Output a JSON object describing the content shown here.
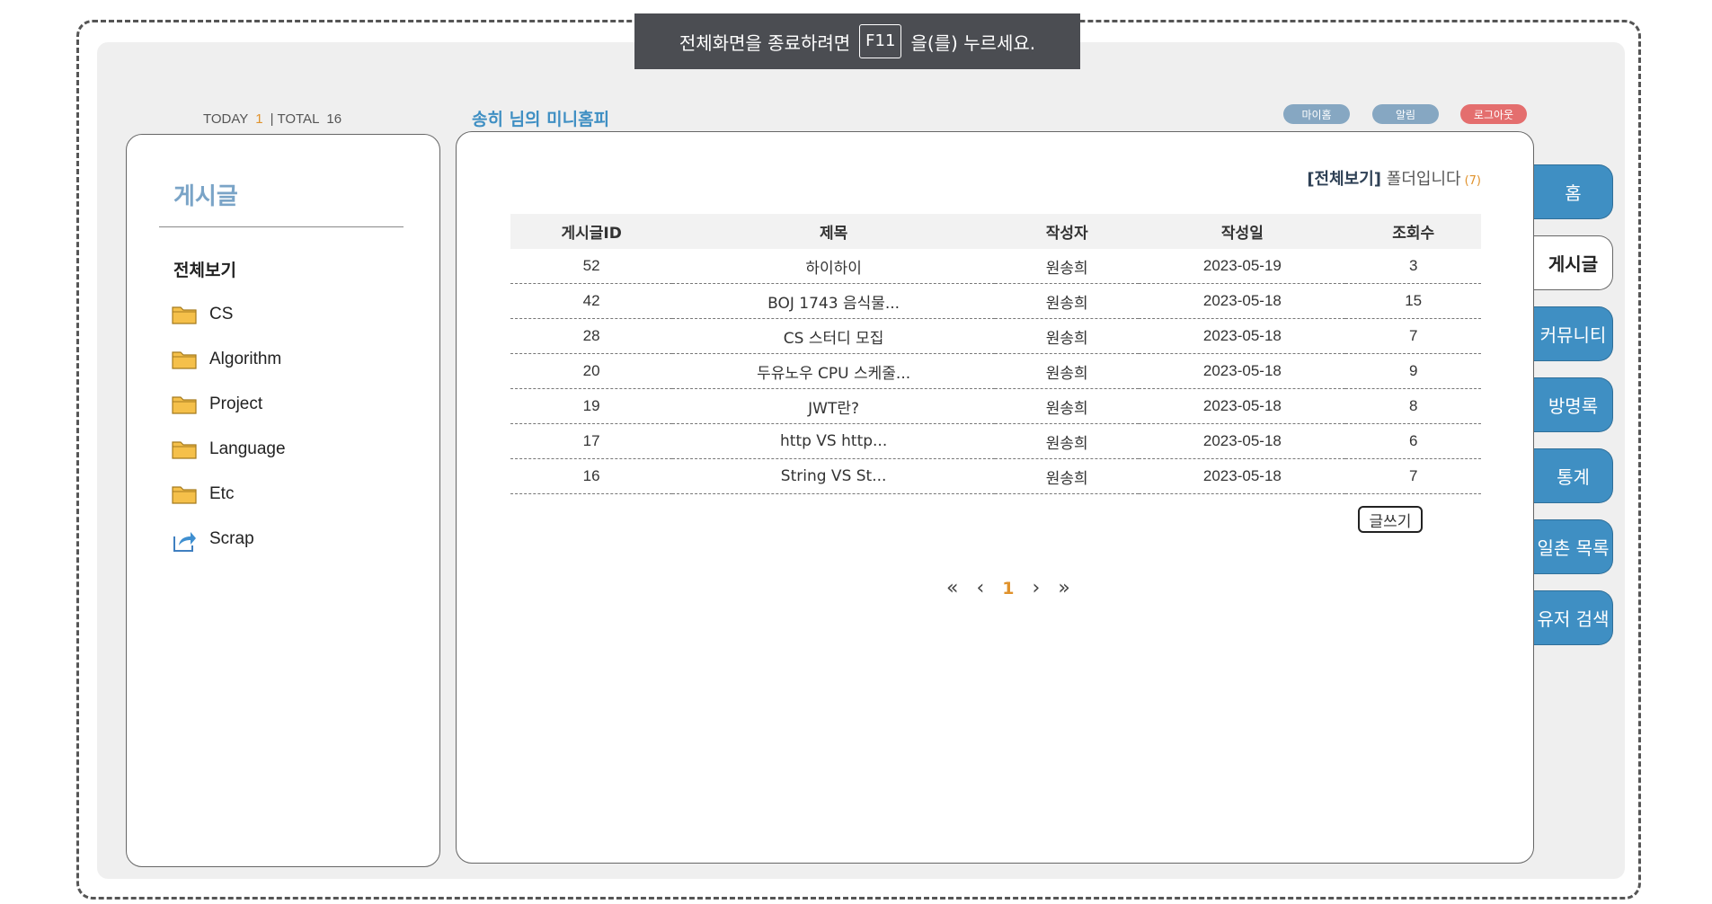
{
  "fullscreen_notice": {
    "before": "전체화면을 종료하려면",
    "key": "F11",
    "after": "을(를) 누르세요."
  },
  "counter": {
    "today_label": "TODAY",
    "today_value": "1",
    "separator": "|",
    "total_label": "TOTAL",
    "total_value": "16"
  },
  "homepage_title": "송히 님의 미니홈피",
  "top_buttons": {
    "myhome": "마이홈",
    "alarm": "알림",
    "logout": "로그아웃"
  },
  "sidebar": {
    "title": "게시글",
    "all_label": "전체보기",
    "folders": [
      {
        "label": "CS",
        "icon": "folder-icon"
      },
      {
        "label": "Algorithm",
        "icon": "folder-icon"
      },
      {
        "label": "Project",
        "icon": "folder-icon"
      },
      {
        "label": "Language",
        "icon": "folder-icon"
      },
      {
        "label": "Etc",
        "icon": "folder-icon"
      },
      {
        "label": "Scrap",
        "icon": "share-icon"
      }
    ]
  },
  "folder_note": {
    "name": "[전체보기]",
    "text": "폴더입니다",
    "count": "(7)"
  },
  "table": {
    "headers": [
      "게시글ID",
      "제목",
      "작성자",
      "작성일",
      "조회수"
    ],
    "rows": [
      [
        "52",
        "하이하이",
        "원송희",
        "2023-05-19",
        "3"
      ],
      [
        "42",
        "BOJ 1743 음식물...",
        "원송희",
        "2023-05-18",
        "15"
      ],
      [
        "28",
        "CS 스터디 모집",
        "원송희",
        "2023-05-18",
        "7"
      ],
      [
        "20",
        "두유노우 CPU 스케줄...",
        "원송희",
        "2023-05-18",
        "9"
      ],
      [
        "19",
        "JWT란?",
        "원송희",
        "2023-05-18",
        "8"
      ],
      [
        "17",
        "http VS http...",
        "원송희",
        "2023-05-18",
        "6"
      ],
      [
        "16",
        "String VS St...",
        "원송희",
        "2023-05-18",
        "7"
      ]
    ]
  },
  "write_button": "글쓰기",
  "pagination": {
    "first": "«",
    "prev": "‹",
    "current": "1",
    "next": "›",
    "last": "»"
  },
  "tabs": [
    "홈",
    "게시글",
    "커뮤니티",
    "방명록",
    "통계",
    "일촌 목록",
    "유저 검색"
  ],
  "colors": {
    "accent": "#3f8fc3",
    "highlight": "#e0922c",
    "logout": "#e46e6e"
  }
}
